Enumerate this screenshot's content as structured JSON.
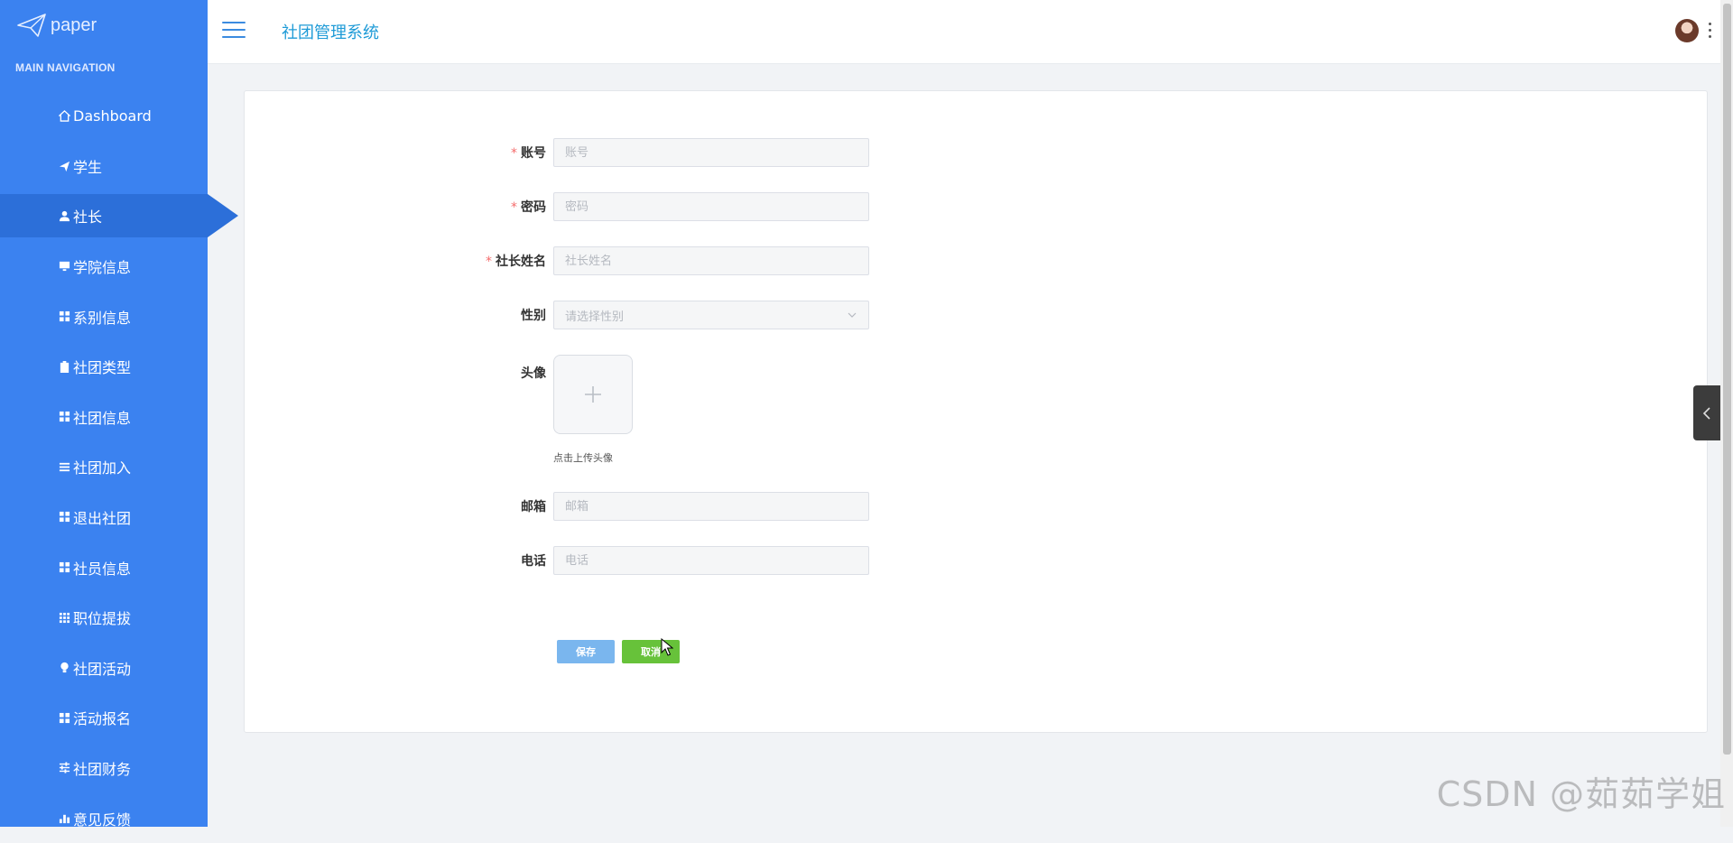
{
  "app": {
    "logo_text": "paper",
    "title": "社团管理系统"
  },
  "sidebar": {
    "heading": "MAIN NAVIGATION",
    "items": [
      {
        "label": "Dashboard",
        "icon": "home-icon"
      },
      {
        "label": "学生",
        "icon": "paper-plane-icon"
      },
      {
        "label": "社长",
        "icon": "user-icon",
        "active": true
      },
      {
        "label": "学院信息",
        "icon": "monitor-icon"
      },
      {
        "label": "系别信息",
        "icon": "grid-icon"
      },
      {
        "label": "社团类型",
        "icon": "clipboard-icon"
      },
      {
        "label": "社团信息",
        "icon": "grid-icon"
      },
      {
        "label": "社团加入",
        "icon": "list-icon"
      },
      {
        "label": "退出社团",
        "icon": "grid-icon"
      },
      {
        "label": "社员信息",
        "icon": "grid-icon"
      },
      {
        "label": "职位提拔",
        "icon": "grid-3x3-icon"
      },
      {
        "label": "社团活动",
        "icon": "bulb-icon"
      },
      {
        "label": "活动报名",
        "icon": "grid-icon"
      },
      {
        "label": "社团财务",
        "icon": "sliders-icon"
      },
      {
        "label": "意见反馈",
        "icon": "bar-chart-icon"
      }
    ]
  },
  "form": {
    "account": {
      "label": "账号",
      "placeholder": "账号",
      "value": "",
      "required": true
    },
    "password": {
      "label": "密码",
      "placeholder": "密码",
      "value": "",
      "required": true
    },
    "leader_name": {
      "label": "社长姓名",
      "placeholder": "社长姓名",
      "value": "",
      "required": true
    },
    "gender": {
      "label": "性别",
      "placeholder": "请选择性别"
    },
    "avatar": {
      "label": "头像",
      "hint": "点击上传头像"
    },
    "email": {
      "label": "邮箱",
      "placeholder": "邮箱",
      "value": ""
    },
    "phone": {
      "label": "电话",
      "placeholder": "电话",
      "value": ""
    },
    "save_label": "保存",
    "cancel_label": "取消"
  },
  "watermark": "CSDN @茹茹学姐",
  "colors": {
    "sidebar": "#3b82f0",
    "sidebar_active": "#2c6fd9",
    "title": "#1f9bd7",
    "save_button": "#7ab6ee",
    "cancel_button": "#67c23a",
    "required_star": "#f56c6c"
  }
}
